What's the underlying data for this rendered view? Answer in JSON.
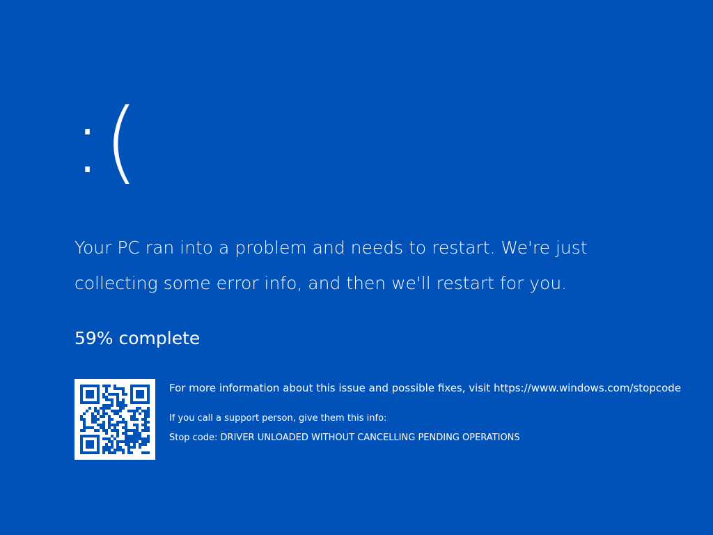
{
  "screen": {
    "background_color": "#0052b8",
    "text_color": "#ffffff"
  },
  "sad_face": ":(",
  "message": "Your PC ran into a problem and needs to restart. We're just collecting some error info, and then we'll restart for you.",
  "progress": {
    "text": "59% complete",
    "percent": 59
  },
  "qr_code": {
    "icon": "qr-code-icon"
  },
  "info": {
    "more_info": "For more information about this issue and possible fixes, visit https://www.windows.com/stopcode",
    "support": "If you call a support person, give them this info:",
    "stop_code": "Stop code: DRIVER UNLOADED WITHOUT CANCELLING PENDING OPERATIONS"
  }
}
